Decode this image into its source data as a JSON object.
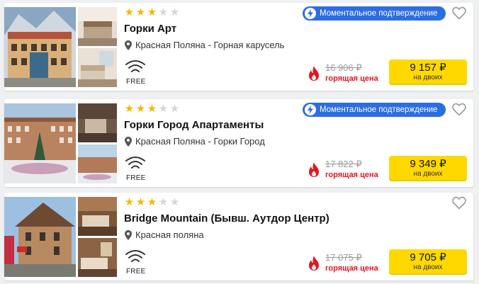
{
  "hotels": [
    {
      "stars_filled": 3,
      "stars_total": 5,
      "name": "Горки Арт",
      "location": "Красная Поляна - Горная карусель",
      "amenity_label": "FREE",
      "amenity_icon": "wifi-icon",
      "badge": "Моментальное подтверждение",
      "old_price": "16 906 ₽",
      "deal_label": "горящая цена",
      "price": "9 157 ₽",
      "price_note": "на двоих"
    },
    {
      "stars_filled": 3,
      "stars_total": 5,
      "name": "Горки Город Апартаменты",
      "location": "Красная Поляна - Горки Город",
      "amenity_label": "FREE",
      "amenity_icon": "wifi-icon",
      "badge": "Моментальное подтверждение",
      "old_price": "17 822 ₽",
      "deal_label": "горящая цена",
      "price": "9 349 ₽",
      "price_note": "на двоих"
    },
    {
      "stars_filled": 3,
      "stars_total": 5,
      "name": "Bridge Mountain (Бывш. Аутдор Центр)",
      "location": "Красная поляна",
      "amenity_label": "FREE",
      "amenity_icon": "wifi-icon",
      "badge": "",
      "old_price": "17 075 ₽",
      "deal_label": "горящая цена",
      "price": "9 705 ₽",
      "price_note": "на двоих"
    }
  ],
  "colors": {
    "badge": "#2c6de1",
    "price_button": "#ffd800",
    "hot": "#e8141c",
    "star_on": "#f5b800",
    "star_off": "#d6d6d6"
  }
}
